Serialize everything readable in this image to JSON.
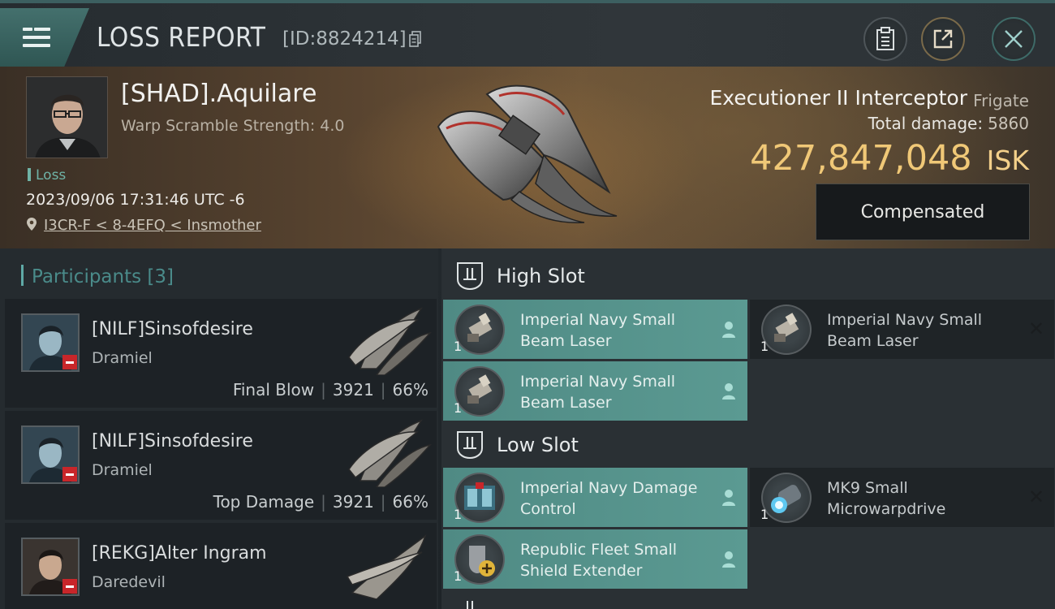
{
  "header": {
    "title": "LOSS REPORT",
    "report_id": "[ID:8824214]",
    "menu_icon": "hamburger-menu-icon",
    "buttons": [
      "clipboard-icon",
      "share-icon",
      "close-icon"
    ]
  },
  "victim": {
    "name": "[SHAD].Aquilare",
    "scram": "Warp Scramble Strength: 4.0",
    "status": "Loss",
    "timestamp": "2023/09/06 17:31:46 UTC -6",
    "location": "I3CR-F < 8-4EFQ < Insmother",
    "ship_name": "Executioner II Interceptor",
    "ship_class": "Frigate",
    "total_damage_label": "Total damage:",
    "total_damage": "5860",
    "isk_value": "427,847,048",
    "isk_unit": "ISK",
    "compensated_label": "Compensated"
  },
  "participants": {
    "label": "Participants",
    "count": "[3]",
    "items": [
      {
        "name": "[NILF]Sinsofdesire",
        "ship": "Dramiel",
        "role": "Final Blow",
        "damage": "3921",
        "percent": "66%"
      },
      {
        "name": "[NILF]Sinsofdesire",
        "ship": "Dramiel",
        "role": "Top Damage",
        "damage": "3921",
        "percent": "66%"
      },
      {
        "name": "[REKG]Alter Ingram",
        "ship": "Daredevil"
      }
    ]
  },
  "fitting": {
    "high_slot": {
      "title": "High Slot",
      "modules": [
        {
          "name": "Imperial Navy Small Beam Laser",
          "qty": "1",
          "state": "destroyed"
        },
        {
          "name": "Imperial Navy Small Beam Laser",
          "qty": "1",
          "state": "dropped"
        },
        {
          "name": "Imperial Navy Small Beam Laser",
          "qty": "1",
          "state": "destroyed"
        }
      ]
    },
    "low_slot": {
      "title": "Low Slot",
      "modules": [
        {
          "name": "Imperial Navy Damage Control",
          "qty": "1",
          "state": "destroyed"
        },
        {
          "name": "MK9 Small Microwarpdrive",
          "qty": "1",
          "state": "dropped"
        },
        {
          "name": "Republic Fleet Small Shield Extender",
          "qty": "1",
          "state": "destroyed"
        }
      ]
    }
  },
  "colors": {
    "accent_teal": "#5b9a92",
    "isk_gold": "#f0c877",
    "penalty_red": "#c8262a"
  }
}
